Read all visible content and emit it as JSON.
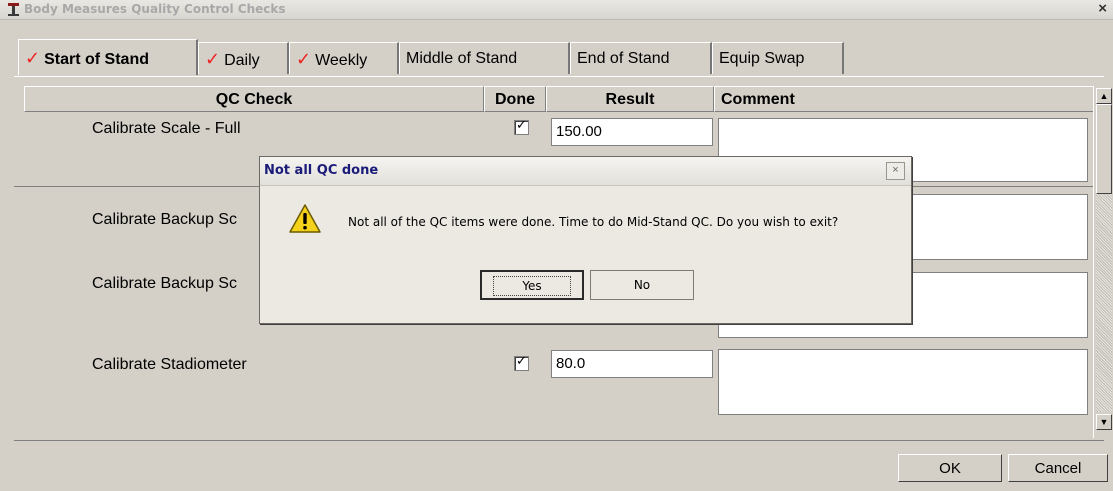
{
  "window": {
    "title": "Body Measures Quality Control Checks",
    "close_glyph": "×"
  },
  "tabs": [
    {
      "label": "Start of Stand",
      "checked": true,
      "active": true
    },
    {
      "label": "Daily",
      "checked": true,
      "active": false
    },
    {
      "label": "Weekly",
      "checked": true,
      "active": false
    },
    {
      "label": "Middle of Stand",
      "checked": false,
      "active": false
    },
    {
      "label": "End of Stand",
      "checked": false,
      "active": false
    },
    {
      "label": "Equip Swap",
      "checked": false,
      "active": false
    }
  ],
  "tab_check_glyph": "✓",
  "grid": {
    "columns": [
      "QC Check",
      "Done",
      "Result",
      "Comment"
    ],
    "rows": [
      {
        "check": "Calibrate Scale - Full",
        "done": true,
        "result": "150.00",
        "comment": ""
      },
      {
        "check": "Calibrate Backup Sc",
        "done": true,
        "result": "",
        "comment": ""
      },
      {
        "check": "Calibrate Backup Sc",
        "done": true,
        "result": "",
        "comment": ""
      },
      {
        "check": "Calibrate Stadiometer",
        "done": true,
        "result": "80.0",
        "comment": ""
      }
    ]
  },
  "scroll": {
    "up": "▲",
    "down": "▼"
  },
  "buttons": {
    "ok": "OK",
    "cancel": "Cancel"
  },
  "dialog": {
    "title": "Not all QC done",
    "close_glyph": "×",
    "message": "Not all of the QC items were done. Time to do Mid-Stand QC. Do you wish to exit?",
    "yes_label": "Yes",
    "no_label": "No",
    "icon": "warning-icon"
  },
  "colors": {
    "check_red": "#e22222",
    "dialog_title": "#1b1b7a",
    "warning_yellow": "#f5d21a"
  }
}
